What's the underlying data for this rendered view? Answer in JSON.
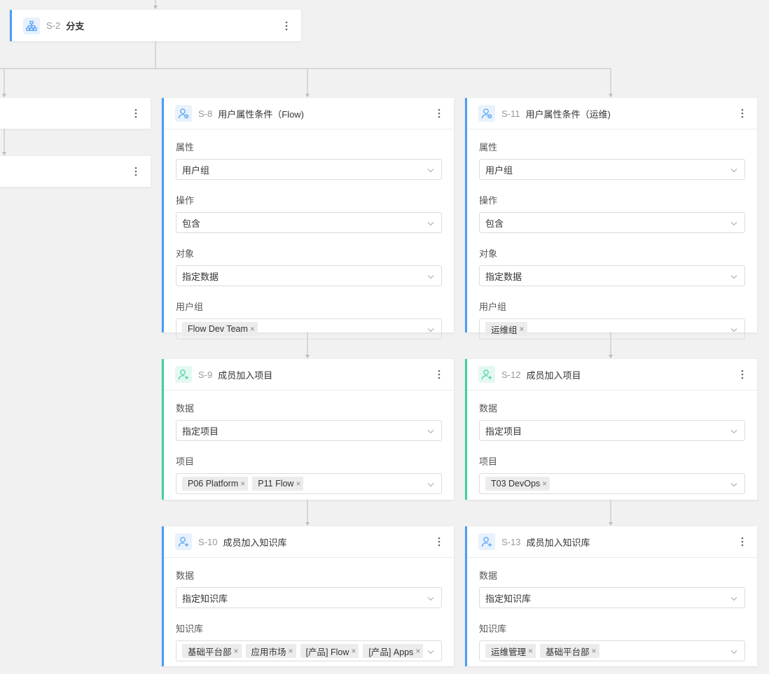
{
  "branch_node": {
    "id": "S-2",
    "title": "分支"
  },
  "left_cards": [
    {},
    {}
  ],
  "condition_cards": [
    {
      "id": "S-8",
      "title": "用户属性条件（Flow)",
      "fields": [
        {
          "label": "属性",
          "value": "用户组"
        },
        {
          "label": "操作",
          "value": "包含"
        },
        {
          "label": "对象",
          "value": "指定数据"
        }
      ],
      "tag_field": {
        "label": "用户组",
        "tags": [
          "Flow Dev Team"
        ]
      }
    },
    {
      "id": "S-11",
      "title": "用户属性条件（运维)",
      "fields": [
        {
          "label": "属性",
          "value": "用户组"
        },
        {
          "label": "操作",
          "value": "包含"
        },
        {
          "label": "对象",
          "value": "指定数据"
        }
      ],
      "tag_field": {
        "label": "用户组",
        "tags": [
          "运维组"
        ]
      }
    }
  ],
  "project_cards": [
    {
      "id": "S-9",
      "title": "成员加入项目",
      "fields": [
        {
          "label": "数据",
          "value": "指定项目"
        }
      ],
      "tag_field": {
        "label": "项目",
        "tags": [
          "P06 Platform",
          "P11 Flow"
        ]
      }
    },
    {
      "id": "S-12",
      "title": "成员加入项目",
      "fields": [
        {
          "label": "数据",
          "value": "指定项目"
        }
      ],
      "tag_field": {
        "label": "项目",
        "tags": [
          "T03 DevOps"
        ]
      }
    }
  ],
  "kb_cards": [
    {
      "id": "S-10",
      "title": "成员加入知识库",
      "fields": [
        {
          "label": "数据",
          "value": "指定知识库"
        }
      ],
      "tag_field": {
        "label": "知识库",
        "tags": [
          "基础平台部",
          "应用市场",
          "[产品] Flow",
          "[产品] Apps"
        ]
      }
    },
    {
      "id": "S-13",
      "title": "成员加入知识库",
      "fields": [
        {
          "label": "数据",
          "value": "指定知识库"
        }
      ],
      "tag_field": {
        "label": "知识库",
        "tags": [
          "运维管理",
          "基础平台部"
        ]
      }
    }
  ],
  "icons": {
    "branch": "branch-icon",
    "condition": "user-condition-icon",
    "add_member": "user-add-icon",
    "more": "more-vertical-icon",
    "dropdown": "chevron-down-icon",
    "tag_remove": "close-icon"
  },
  "colors": {
    "condition_accent": "#4a9df8",
    "action_accent": "#3ecfa5"
  }
}
